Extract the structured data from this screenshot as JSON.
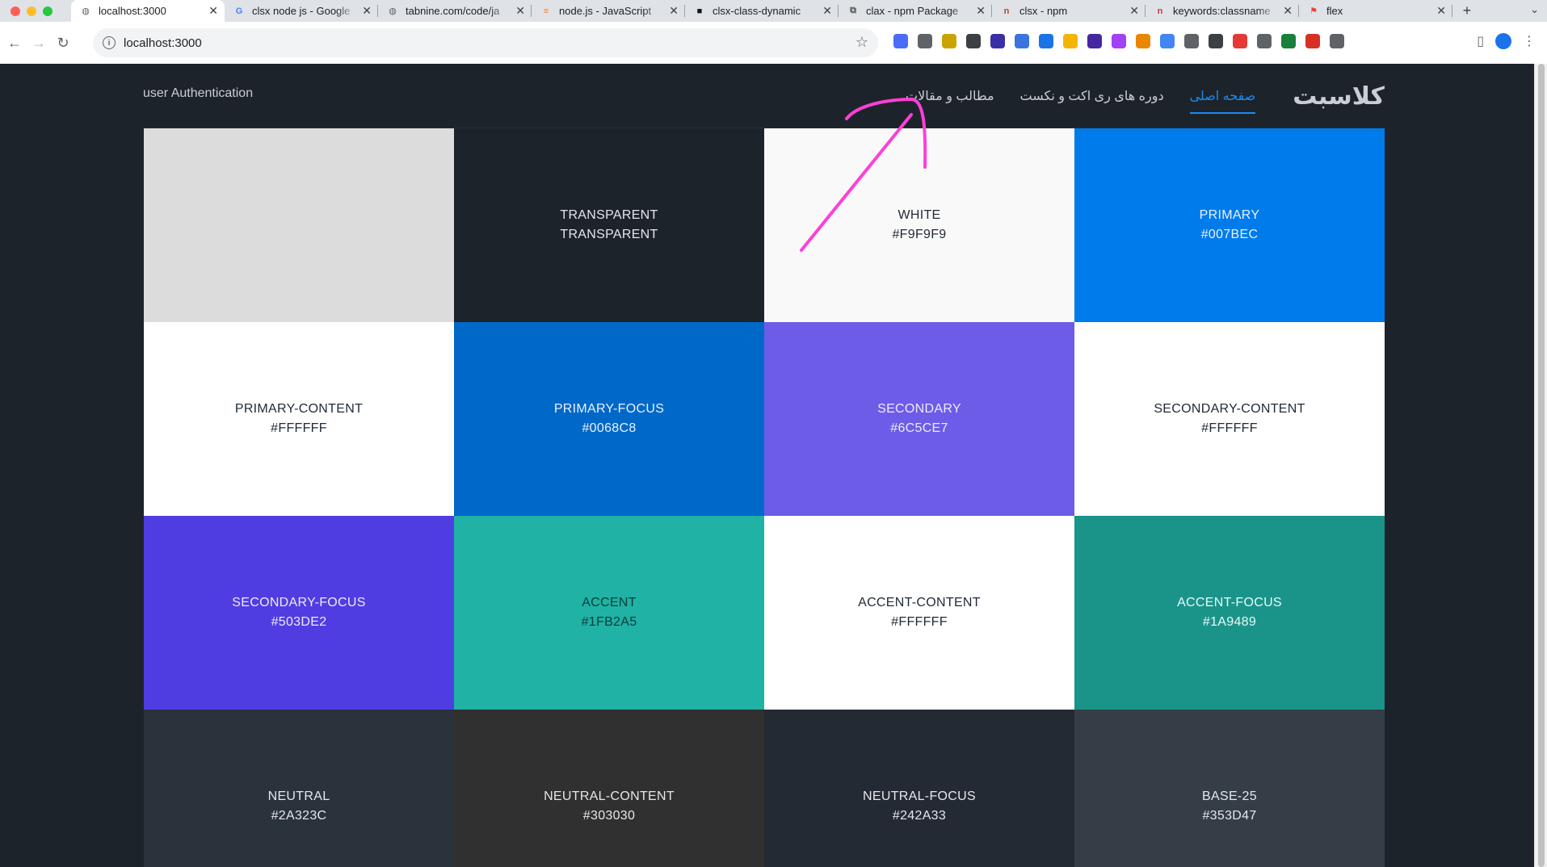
{
  "browser": {
    "tabs": [
      {
        "title": "localhost:3000",
        "active": true,
        "icon": "globe-icon"
      },
      {
        "title": "clsx node js - Google",
        "active": false,
        "icon": "google-icon"
      },
      {
        "title": "tabnine.com/code/ja",
        "active": false,
        "icon": "globe-icon"
      },
      {
        "title": "node.js - JavaScript",
        "active": false,
        "icon": "stackoverflow-icon"
      },
      {
        "title": "clsx-class-dynamic",
        "active": false,
        "icon": "square-icon"
      },
      {
        "title": "clax - npm Package",
        "active": false,
        "icon": "package-icon"
      },
      {
        "title": "clsx - npm",
        "active": false,
        "icon": "npm-icon"
      },
      {
        "title": "keywords:classname",
        "active": false,
        "icon": "npm-icon"
      },
      {
        "title": "flex",
        "active": false,
        "icon": "flag-icon"
      }
    ],
    "address": "localhost:3000",
    "extension_colors": [
      "#4a6cf7",
      "#5f6368",
      "#c9a400",
      "#3c4043",
      "#3b2fa8",
      "#3b74e0",
      "#1a73e8",
      "#f4b400",
      "#4527a0",
      "#a142f4",
      "#ea8600",
      "#4285f4",
      "#5f6368",
      "#3c4043",
      "#e53935",
      "#5f6368",
      "#188038",
      "#d93025",
      "#5f6368"
    ]
  },
  "site": {
    "auth_label": "user Authentication",
    "logo_text": "کلاسبت",
    "nav": [
      {
        "label": "صفحه اصلی",
        "active": true
      },
      {
        "label": "دوره های ری اکت و نکست",
        "active": false
      },
      {
        "label": "مطالب و مقالات",
        "active": false
      }
    ]
  },
  "swatches": [
    {
      "name": "",
      "hex": "",
      "bg": "#dcdcdc",
      "fg": "#1f2937"
    },
    {
      "name": "TRANSPARENT",
      "hex": "TRANSPARENT",
      "bg": "#1d232a",
      "fg": "#e5e7eb"
    },
    {
      "name": "WHITE",
      "hex": "#F9F9F9",
      "bg": "#f9f9f9",
      "fg": "#1f2937"
    },
    {
      "name": "PRIMARY",
      "hex": "#007BEC",
      "bg": "#007bec",
      "fg": "#e8f2ff"
    },
    {
      "name": "PRIMARY-CONTENT",
      "hex": "#FFFFFF",
      "bg": "#ffffff",
      "fg": "#1f2937"
    },
    {
      "name": "PRIMARY-FOCUS",
      "hex": "#0068C8",
      "bg": "#0068c8",
      "fg": "#e8f2ff"
    },
    {
      "name": "SECONDARY",
      "hex": "#6C5CE7",
      "bg": "#6c5ce7",
      "fg": "#ecebff"
    },
    {
      "name": "SECONDARY-CONTENT",
      "hex": "#FFFFFF",
      "bg": "#ffffff",
      "fg": "#1f2937"
    },
    {
      "name": "SECONDARY-FOCUS",
      "hex": "#503DE2",
      "bg": "#503de2",
      "fg": "#ecebff"
    },
    {
      "name": "ACCENT",
      "hex": "#1FB2A5",
      "bg": "#1fb2a5",
      "fg": "#0d3d39"
    },
    {
      "name": "ACCENT-CONTENT",
      "hex": "#FFFFFF",
      "bg": "#ffffff",
      "fg": "#1f2937"
    },
    {
      "name": "ACCENT-FOCUS",
      "hex": "#1A9489",
      "bg": "#1a9489",
      "fg": "#e6fbf9"
    },
    {
      "name": "NEUTRAL",
      "hex": "#2A323C",
      "bg": "#2a323c",
      "fg": "#e5e7eb"
    },
    {
      "name": "NEUTRAL-CONTENT",
      "hex": "#303030",
      "bg": "#303030",
      "fg": "#e5e7eb"
    },
    {
      "name": "NEUTRAL-FOCUS",
      "hex": "#242A33",
      "bg": "#242a33",
      "fg": "#e5e7eb"
    },
    {
      "name": "BASE-25",
      "hex": "#353D47",
      "bg": "#353d47",
      "fg": "#e5e7eb"
    }
  ],
  "annotation": {
    "color": "#ff3fd8"
  }
}
